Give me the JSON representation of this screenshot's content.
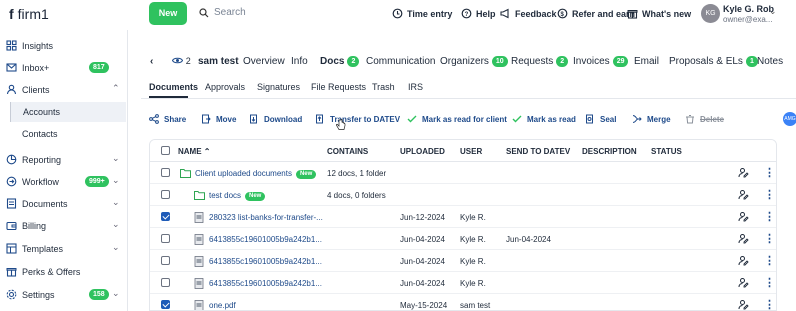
{
  "app": {
    "name": "firm1",
    "logo_letter": "f"
  },
  "topbar": {
    "new_label": "New",
    "search_placeholder": "Search",
    "time_entry": "Time entry",
    "help": "Help",
    "feedback": "Feedback",
    "refer": "Refer and earn",
    "whats_new": "What's new",
    "user_initials": "KG",
    "user_name": "Kyle G. Rob",
    "user_role": "owner@exa..."
  },
  "sidebar": {
    "items": [
      {
        "label": "Insights",
        "icon": "grid-icon"
      },
      {
        "label": "Inbox+",
        "icon": "mail-icon",
        "badge": "817"
      },
      {
        "label": "Clients",
        "icon": "person-icon"
      },
      {
        "label": "Reporting",
        "icon": "pie-chart-icon"
      },
      {
        "label": "Workflow",
        "icon": "flow-icon",
        "badge": "999+"
      },
      {
        "label": "Documents",
        "icon": "document-icon"
      },
      {
        "label": "Billing",
        "icon": "wallet-icon"
      },
      {
        "label": "Templates",
        "icon": "template-icon"
      },
      {
        "label": "Perks & Offers",
        "icon": "gift-icon"
      },
      {
        "label": "Settings",
        "icon": "gear-icon",
        "badge": "158"
      }
    ],
    "sub_items": [
      "Accounts",
      "Contacts"
    ]
  },
  "client": {
    "watchers": "2",
    "name": "sam test",
    "tabs": [
      {
        "label": "Overview"
      },
      {
        "label": "Info"
      },
      {
        "label": "Docs",
        "badge": "2"
      },
      {
        "label": "Communication"
      },
      {
        "label": "Organizers",
        "badge": "10"
      },
      {
        "label": "Requests",
        "badge": "2"
      },
      {
        "label": "Invoices",
        "badge": "29"
      },
      {
        "label": "Email"
      },
      {
        "label": "Proposals & ELs",
        "badge": "1"
      },
      {
        "label": "Notes"
      }
    ]
  },
  "subtabs": [
    "Documents",
    "Approvals",
    "Signatures",
    "File Requests",
    "Trash",
    "IRS"
  ],
  "toolbar": {
    "share": "Share",
    "move": "Move",
    "download": "Download",
    "transfer": "Transfer to DATEV",
    "mark_client": "Mark as read for client",
    "mark_read": "Mark as read",
    "seal": "Seal",
    "merge": "Merge",
    "delete": "Delete",
    "bubble": "AMG"
  },
  "table": {
    "headers": {
      "name": "NAME",
      "contains": "CONTAINS",
      "uploaded": "UPLOADED",
      "user": "USER",
      "send": "SEND TO DATEV",
      "description": "DESCRIPTION",
      "status": "STATUS"
    },
    "rows": [
      {
        "name": "Client uploaded documents",
        "badge": "New",
        "contains": "12 docs, 1 folder",
        "uploaded": "",
        "user": "",
        "send": "",
        "type": "folder",
        "checked": false,
        "indent": false
      },
      {
        "name": "test docs",
        "badge": "New",
        "contains": "4 docs, 0 folders",
        "uploaded": "",
        "user": "",
        "send": "",
        "type": "folder",
        "checked": false,
        "indent": true
      },
      {
        "name": "280323 list-banks-for-transfer-...",
        "badge": "",
        "contains": "",
        "uploaded": "Jun-12-2024",
        "user": "Kyle R.",
        "send": "",
        "type": "file",
        "checked": true,
        "indent": true
      },
      {
        "name": "6413855c19601005b9a242b1...",
        "badge": "",
        "contains": "",
        "uploaded": "Jun-04-2024",
        "user": "Kyle R.",
        "send": "Jun-04-2024",
        "type": "file",
        "checked": false,
        "indent": true
      },
      {
        "name": "6413855c19601005b9a242b1...",
        "badge": "",
        "contains": "",
        "uploaded": "Jun-04-2024",
        "user": "Kyle R.",
        "send": "",
        "type": "file",
        "checked": false,
        "indent": true
      },
      {
        "name": "6413855c19601005b9a242b1...",
        "badge": "",
        "contains": "",
        "uploaded": "Jun-04-2024",
        "user": "Kyle R.",
        "send": "",
        "type": "file",
        "checked": false,
        "indent": true
      },
      {
        "name": "one.pdf",
        "badge": "",
        "contains": "",
        "uploaded": "May-15-2024",
        "user": "sam test",
        "send": "",
        "type": "file",
        "checked": true,
        "indent": true
      }
    ]
  },
  "colors": {
    "accent": "#2fc25f",
    "link": "#1e4a8a",
    "primary": "#1e5bb8"
  }
}
